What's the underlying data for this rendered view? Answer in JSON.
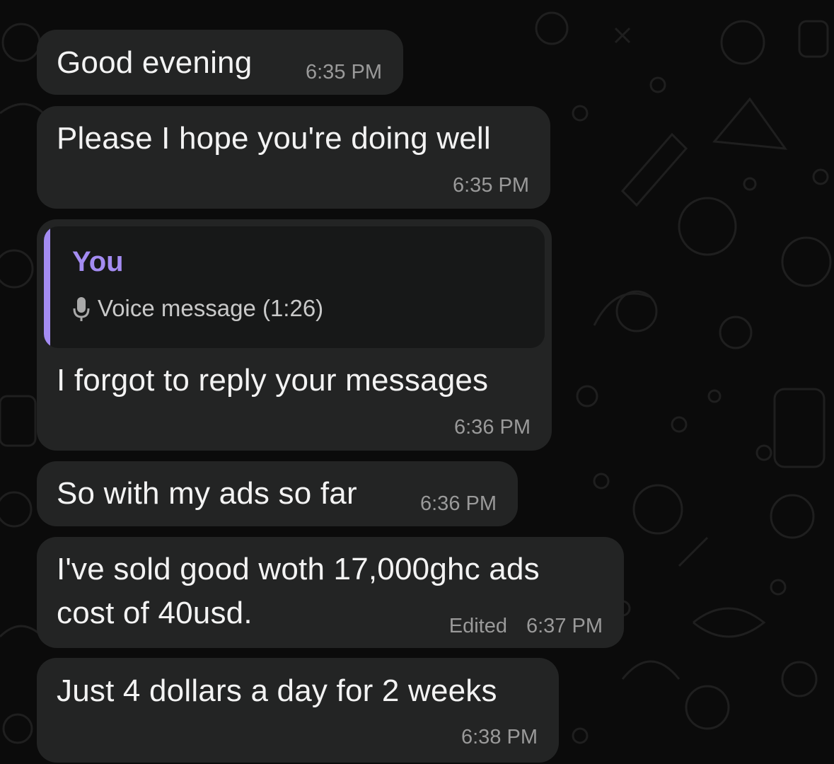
{
  "messages": [
    {
      "text": "Good evening",
      "time": "6:35 PM"
    },
    {
      "text": "Please I hope you're doing well",
      "time": "6:35 PM"
    },
    {
      "reply": {
        "author": "You",
        "preview": "Voice message (1:26)",
        "icon": "microphone-icon"
      },
      "text": "I forgot to reply your messages",
      "time": "6:36 PM"
    },
    {
      "text": "So with my ads so far",
      "time": "6:36 PM"
    },
    {
      "lines": [
        "I've sold good woth 17,000ghc  ads",
        "cost of 40usd."
      ],
      "edited": "Edited",
      "time": "6:37 PM"
    },
    {
      "text": "Just 4 dollars a day for 2 weeks",
      "time": "6:38 PM"
    }
  ],
  "colors": {
    "background": "#0b0b0b",
    "bubble": "#232424",
    "quote_accent": "#a48cf2",
    "timestamp": "#9a9a9a"
  }
}
